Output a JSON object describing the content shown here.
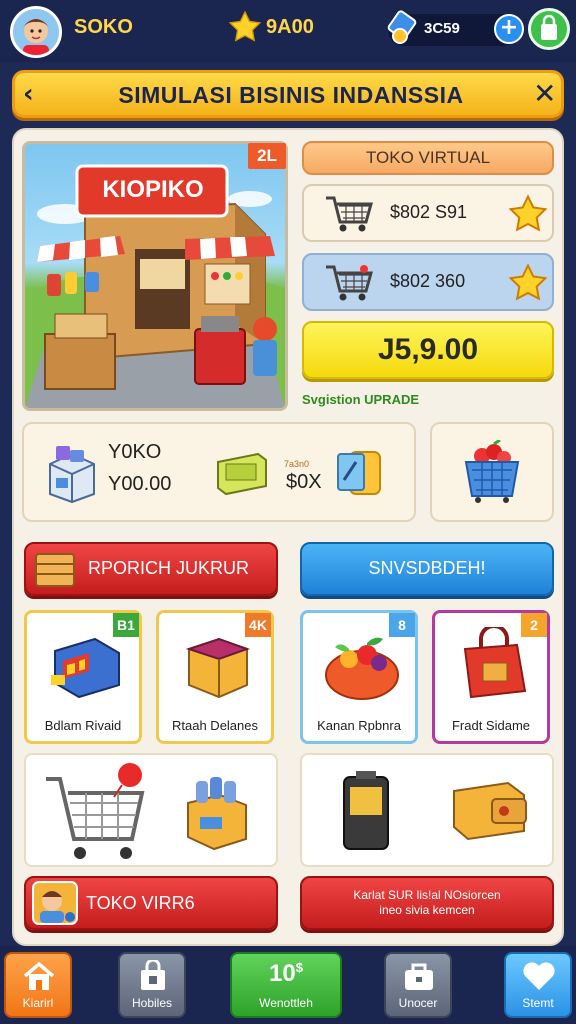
{
  "topbar": {
    "coins_label": "SOKO",
    "stars_value": "9A00",
    "gems_value": "3C59",
    "plus_label": "+"
  },
  "banner": {
    "title": "SIMULASI BISINIS  INDANSSIA",
    "back_glyph": "‹",
    "close_glyph": "✕"
  },
  "scene": {
    "sign": "KIOPIKO",
    "badge": "2L"
  },
  "right_column": {
    "header": "TOKO VIRTUAL",
    "price_1": "$802 S91",
    "price_2": "$802 360",
    "big_value": "J5,9.00",
    "upgrade_label": "Svgistion UPRADE"
  },
  "stats": {
    "line_1": "Y0KO",
    "line_2": "Y00.00",
    "small_label": "7a3n0",
    "value_b": "$0X"
  },
  "buttons": {
    "red_primary": "RPORICH JUKRUR",
    "blue_primary": "SNVSDBDEH!",
    "red_secondary": "TOKO VIRR6",
    "red_tertiary_line1": "Karlat SUR  lis!al NOsiorcen",
    "red_tertiary_line2": "ineo sivia kemcen"
  },
  "items": [
    {
      "name": "Bdlam Rivaid",
      "badge": "B1",
      "badge_color": "#3aa83a"
    },
    {
      "name": "Rtaah Delanes",
      "badge": "4K",
      "badge_color": "#ef7a2b"
    },
    {
      "name": "Kanan Rpbnra",
      "badge": "8",
      "badge_color": "#4aa6e8"
    },
    {
      "name": "Fradt Sidame",
      "badge": "2",
      "badge_color": "#f4a52b"
    }
  ],
  "nav": [
    {
      "label": "Kiarirl",
      "icon": "home-icon"
    },
    {
      "label": "Hobiles",
      "icon": "store-icon"
    },
    {
      "label": "Wenottleh",
      "value": "10",
      "superscript": "$"
    },
    {
      "label": "Unocer",
      "icon": "briefcase-icon"
    },
    {
      "label": "Stemt",
      "icon": "heart-icon"
    }
  ],
  "colors": {
    "background": "#1d2a55",
    "banner": "#ffd94a",
    "panel": "#f6f1e6",
    "accent_red": "#e03131",
    "accent_blue": "#2b92e6",
    "accent_green": "#3ec04a"
  }
}
